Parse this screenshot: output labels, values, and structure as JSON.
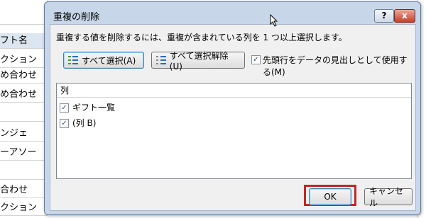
{
  "sheet": {
    "cells": [
      "",
      "フト名",
      "クション",
      "め合わせ",
      "め合わせ",
      "",
      "ンジェ",
      "ーアソー",
      "",
      "合わせ",
      "クション"
    ]
  },
  "dialog": {
    "title": "重複の削除",
    "help_label": "?",
    "close_label": "x",
    "instruction": "重複する値を削除するには、重複が含まれている列を 1 つ以上選択します。",
    "select_all_label": "すべて選択(A)",
    "unselect_all_label": "すべて選択解除(U)",
    "header_checkbox_label": "先頭行をデータの見出しとして使用する(M)",
    "header_checkbox_checked": true,
    "column_header": "列",
    "columns": [
      {
        "label": "ギフト一覧",
        "checked": true
      },
      {
        "label": "(列 B)",
        "checked": true
      }
    ],
    "ok_label": "OK",
    "cancel_label": "キャンセル"
  }
}
